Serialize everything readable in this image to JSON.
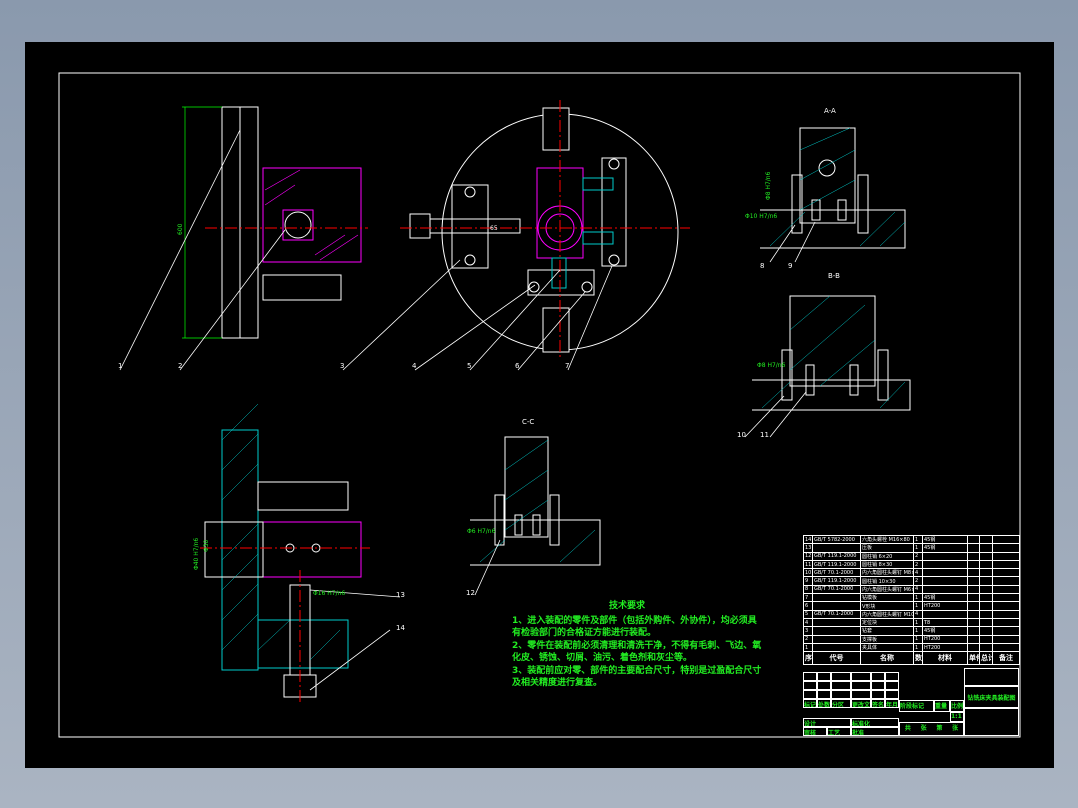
{
  "drawing": {
    "section_labels": [
      "A-A",
      "B-B",
      "C-C"
    ],
    "callouts": [
      "1",
      "2",
      "3",
      "4",
      "5",
      "6",
      "7",
      "8",
      "9",
      "10",
      "11",
      "12",
      "13",
      "14"
    ],
    "dimensions": {
      "height": "600",
      "bore": "65",
      "fit_a": "Φ40 H7/n6",
      "fit_b": "Φ30",
      "fit_c": "Φ16 H7/n6",
      "fit_d": "Φ8 H7/n6",
      "fit_e": "Φ10 H7/n6",
      "fit_f": "Φ8 H7/n6",
      "fit_g": "Φ6 H7/n6"
    },
    "colors": {
      "background": "#000000",
      "outline": "#ffffff",
      "centerline": "#ff0000",
      "part": "#ff00ff",
      "hatch": "#00cccc",
      "text": "#22ee22"
    }
  },
  "tech_requirements": {
    "title": "技术要求",
    "lines": [
      "1、进入装配的零件及部件（包括外购件、外协件），均必须具有检验部门的合格证方能进行装配。",
      "2、零件在装配前必须清理和清洗干净，不得有毛刺、飞边、氧化皮、锈蚀、切屑、油污、着色剂和灰尘等。",
      "3、装配前应对零、部件的主要配合尺寸，特别是过盈配合尺寸及相关精度进行复查。"
    ]
  },
  "bom": {
    "header": [
      "序号",
      "代号",
      "名称",
      "数量",
      "材料",
      "单件",
      "总计",
      "备注"
    ],
    "weight_label": "重量",
    "rows": [
      [
        "14",
        "GB/T 5782-2000",
        "六角头螺栓 M16×80",
        "1",
        "45钢",
        "",
        "",
        ""
      ],
      [
        "13",
        "",
        "压板",
        "1",
        "45钢",
        "",
        "",
        ""
      ],
      [
        "12",
        "GB/T 119.1-2000",
        "圆柱销 6×20",
        "2",
        "",
        "",
        "",
        ""
      ],
      [
        "11",
        "GB/T 119.1-2000",
        "圆柱销 8×30",
        "2",
        "",
        "",
        "",
        ""
      ],
      [
        "10",
        "GB/T 70.1-2000",
        "内六角圆柱头螺钉 M8×25",
        "4",
        "",
        "",
        "",
        ""
      ],
      [
        "9",
        "GB/T 119.1-2000",
        "圆柱销 10×30",
        "2",
        "",
        "",
        "",
        ""
      ],
      [
        "8",
        "GB/T 70.1-2000",
        "内六角圆柱头螺钉 M6×20",
        "4",
        "",
        "",
        "",
        ""
      ],
      [
        "7",
        "",
        "钻模板",
        "1",
        "45钢",
        "",
        "",
        ""
      ],
      [
        "6",
        "",
        "V形块",
        "1",
        "HT200",
        "",
        "",
        ""
      ],
      [
        "5",
        "GB/T 70.1-2000",
        "内六角圆柱头螺钉 M10×30",
        "4",
        "",
        "",
        "",
        ""
      ],
      [
        "4",
        "",
        "定位块",
        "1",
        "T8",
        "",
        "",
        ""
      ],
      [
        "3",
        "",
        "钻套",
        "1",
        "45钢",
        "",
        "",
        ""
      ],
      [
        "2",
        "",
        "支撑板",
        "1",
        "HT200",
        "",
        "",
        ""
      ],
      [
        "1",
        "",
        "夹具体",
        "1",
        "HT200",
        "",
        "",
        ""
      ]
    ]
  },
  "title_block": {
    "row_labels": [
      "标记",
      "处数",
      "分区",
      "更改文件号",
      "签名",
      "年月日"
    ],
    "design": "设计",
    "standard": "标准化",
    "review": "审核",
    "process": "工艺",
    "approve": "批准",
    "stage": "阶段标记",
    "weight": "重量",
    "scale_label": "比例",
    "scale": "1:1",
    "sheets": [
      "共",
      "张",
      "第",
      "张"
    ],
    "drawing_title": "钻铣床夹具装配图"
  }
}
